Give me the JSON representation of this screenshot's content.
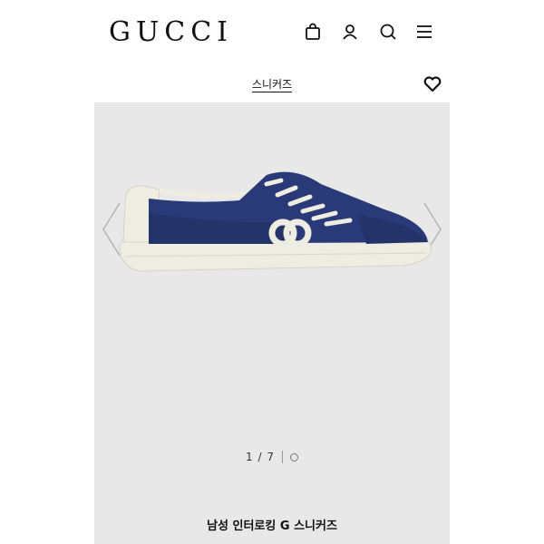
{
  "header": {
    "logo": "GUCCI",
    "icons": [
      "shopping-bag-icon",
      "user-icon",
      "search-icon",
      "menu-icon"
    ]
  },
  "subnav": {
    "category": "스니커즈",
    "wishlist_icon": "heart-icon"
  },
  "gallery": {
    "pager": "1 / 7",
    "prev_icon": "chevron-left-icon",
    "next_icon": "chevron-right-icon"
  },
  "product": {
    "name": "남성 인터로킹 G 스니커즈"
  },
  "colors": {
    "background": "#e8e8e8",
    "shoe_navy": "#25356f",
    "shoe_cream": "#efece2"
  }
}
